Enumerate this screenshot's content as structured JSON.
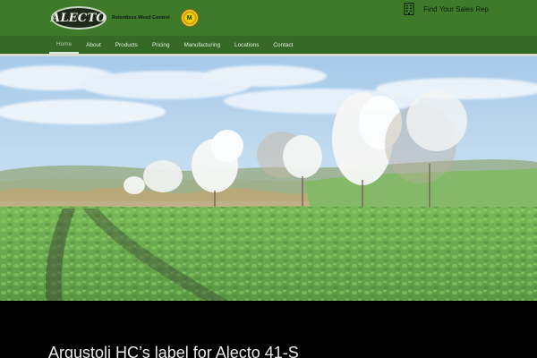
{
  "header": {
    "logo_text": "ALECTO",
    "tagline": "Relentless Weed Control",
    "badge_text": "M",
    "sales_link": "Find Your Sales Rep",
    "sales_icon": "building-icon"
  },
  "nav": {
    "items": [
      {
        "label": "Home",
        "active": true
      },
      {
        "label": "About"
      },
      {
        "label": "Products"
      },
      {
        "label": "Pricing"
      },
      {
        "label": "Manufacturing"
      },
      {
        "label": "Locations"
      },
      {
        "label": "Contact"
      }
    ]
  },
  "main": {
    "headline": "Argustoli HC’s label for Alecto 41-S"
  },
  "colors": {
    "header_green": "#3f7a2a",
    "nav_green": "#356925",
    "footer_black": "#000000",
    "crop_green": "#4f9a3a"
  }
}
